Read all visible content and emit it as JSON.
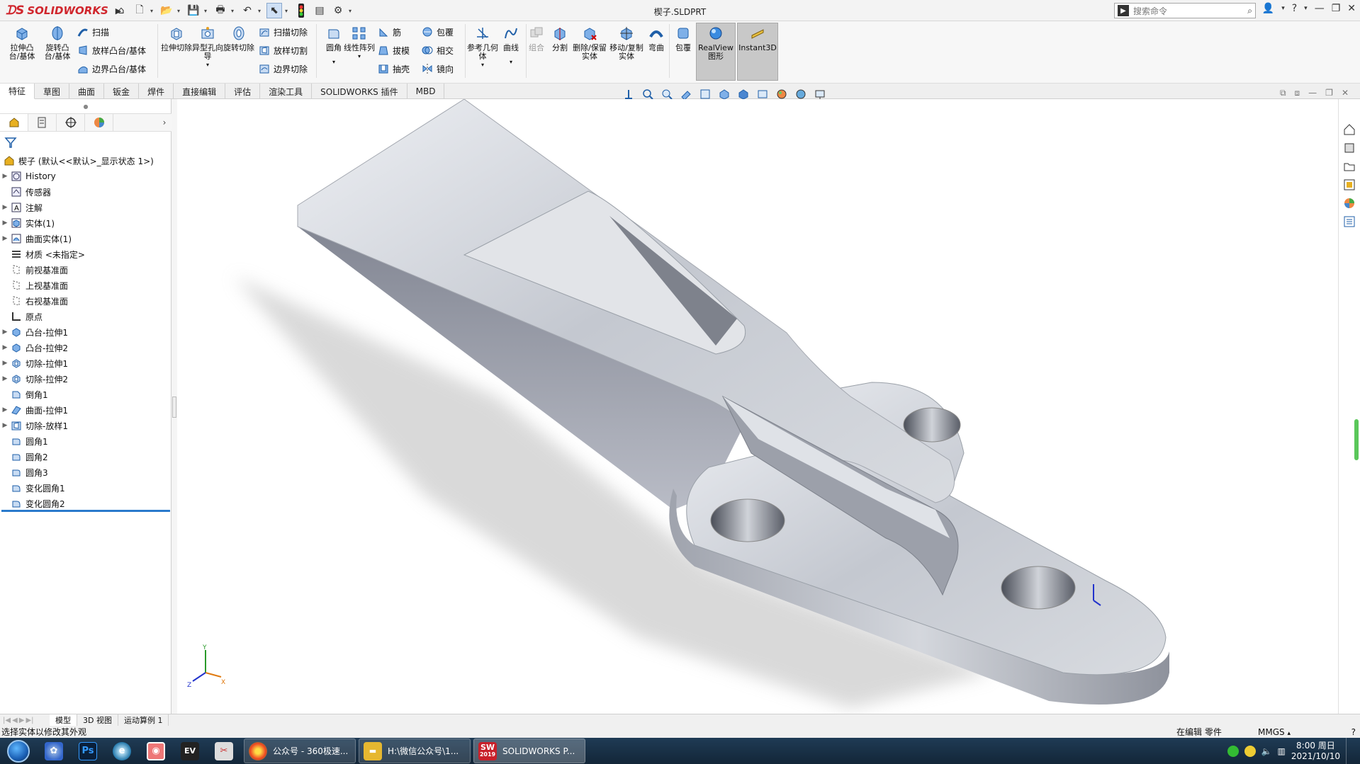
{
  "app": {
    "brand": "SOLIDWORKS",
    "document_title": "楔子.SLDPRT"
  },
  "search": {
    "placeholder": "搜索命令"
  },
  "ribbon": {
    "extrude_boss": "拉伸凸台/基体",
    "revolve_boss": "旋转凸台/基体",
    "sweep": "扫描",
    "loft_boss": "放样凸台/基体",
    "boundary_boss": "边界凸台/基体",
    "extrude_cut": "拉伸切除",
    "hole_wizard": "异型孔向导",
    "revolve_cut": "旋转切除",
    "sweep_cut": "扫描切除",
    "loft_cut": "放样切割",
    "boundary_cut": "边界切除",
    "fillet": "圆角",
    "linear_pattern": "线性阵列",
    "rib": "筋",
    "draft": "拔模",
    "shell": "抽壳",
    "wrap": "包覆",
    "intersect": "相交",
    "mirror": "镜向",
    "ref_geometry": "参考几何体",
    "curves": "曲线",
    "combine": "组合",
    "split": "分割",
    "delete_keep_body": "删除/保留实体",
    "move_copy_body": "移动/复制实体",
    "flex": "弯曲",
    "wrap2": "包覆",
    "realview": "RealView图形",
    "instant3d": "Instant3D"
  },
  "tabs": [
    "特征",
    "草图",
    "曲面",
    "钣金",
    "焊件",
    "直接编辑",
    "评估",
    "渲染工具",
    "SOLIDWORKS 插件",
    "MBD"
  ],
  "feature_tree": {
    "root": "楔子 (默认<<默认>_显示状态 1>)",
    "items": [
      {
        "label": "History",
        "expandable": true,
        "icon": "history-icon"
      },
      {
        "label": "传感器",
        "expandable": false,
        "icon": "sensor-icon"
      },
      {
        "label": "注解",
        "expandable": true,
        "icon": "annotation-icon"
      },
      {
        "label": "实体(1)",
        "expandable": true,
        "icon": "solid-body-icon"
      },
      {
        "label": "曲面实体(1)",
        "expandable": true,
        "icon": "surface-body-icon"
      },
      {
        "label": "材质 <未指定>",
        "expandable": false,
        "icon": "material-icon"
      },
      {
        "label": "前视基准面",
        "expandable": false,
        "icon": "plane-icon"
      },
      {
        "label": "上视基准面",
        "expandable": false,
        "icon": "plane-icon"
      },
      {
        "label": "右视基准面",
        "expandable": false,
        "icon": "plane-icon"
      },
      {
        "label": "原点",
        "expandable": false,
        "icon": "origin-icon"
      },
      {
        "label": "凸台-拉伸1",
        "expandable": true,
        "icon": "boss-extrude-icon"
      },
      {
        "label": "凸台-拉伸2",
        "expandable": true,
        "icon": "boss-extrude-icon"
      },
      {
        "label": "切除-拉伸1",
        "expandable": true,
        "icon": "cut-extrude-icon"
      },
      {
        "label": "切除-拉伸2",
        "expandable": true,
        "icon": "cut-extrude-icon"
      },
      {
        "label": "倒角1",
        "expandable": false,
        "icon": "chamfer-icon"
      },
      {
        "label": "曲面-拉伸1",
        "expandable": true,
        "icon": "surface-extrude-icon"
      },
      {
        "label": "切除-放样1",
        "expandable": true,
        "icon": "cut-loft-icon"
      },
      {
        "label": "圆角1",
        "expandable": false,
        "icon": "fillet-icon"
      },
      {
        "label": "圆角2",
        "expandable": false,
        "icon": "fillet-icon"
      },
      {
        "label": "圆角3",
        "expandable": false,
        "icon": "fillet-icon"
      },
      {
        "label": "变化圆角1",
        "expandable": false,
        "icon": "variable-fillet-icon"
      },
      {
        "label": "变化圆角2",
        "expandable": false,
        "icon": "variable-fillet-icon"
      }
    ]
  },
  "bottom_tabs": [
    "模型",
    "3D 视图",
    "运动算例 1"
  ],
  "status": {
    "message": "选择实体以修改其外观",
    "mode": "在编辑 零件",
    "units": "MMGS"
  },
  "taskbar": {
    "tasks": [
      {
        "label": "公众号 - 360极速...",
        "color": "#e0402a"
      },
      {
        "label": "H:\\微信公众号\\1...",
        "color": "#e6b730"
      },
      {
        "label": "SOLIDWORKS P...",
        "color": "#c8202a"
      }
    ],
    "sw_badge": "2019",
    "time": "8:00 周日",
    "date": "2021/10/10"
  },
  "colors": {
    "accent": "#2a7acc",
    "brand_red": "#d0262d"
  }
}
